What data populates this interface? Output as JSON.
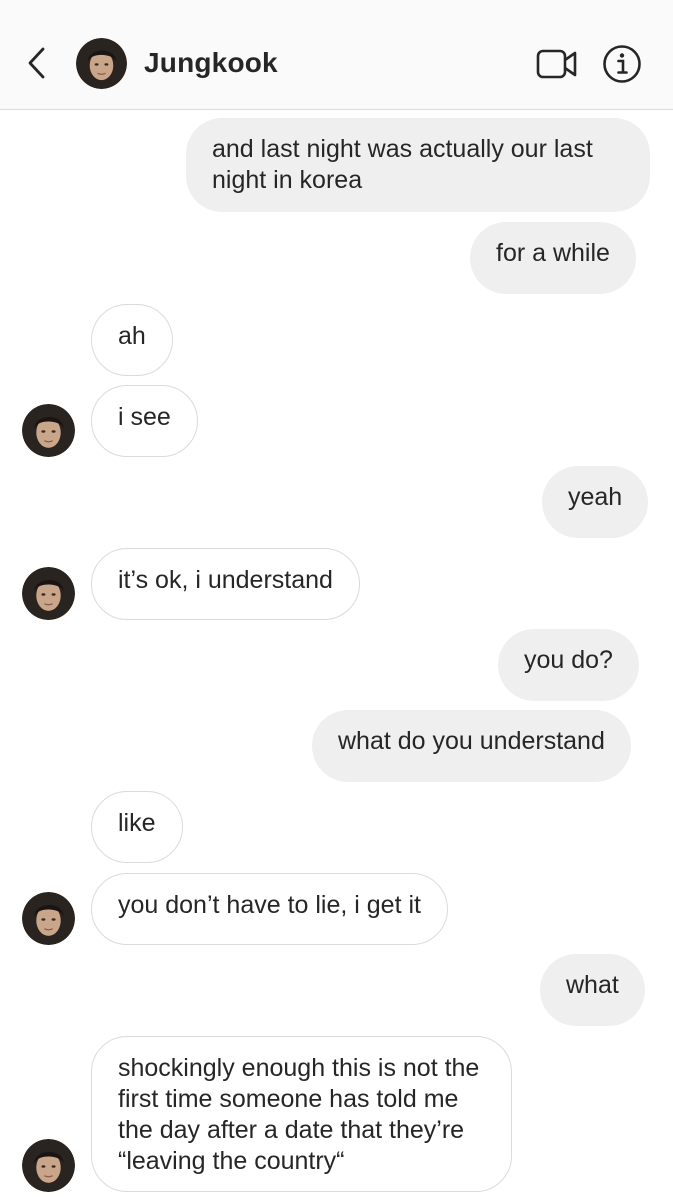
{
  "header": {
    "contact_name": "Jungkook",
    "back_icon": "chevron-left-icon",
    "video_icon": "video-camera-icon",
    "info_icon": "info-icon"
  },
  "colors": {
    "outgoing_bubble": "#efefef",
    "incoming_border": "#dbdbdb",
    "header_bg": "#fafafa",
    "text": "#262626"
  },
  "messages": [
    {
      "direction": "outgoing",
      "text": "and last night was actually our last night in korea"
    },
    {
      "direction": "outgoing",
      "text": "for a while"
    },
    {
      "direction": "incoming",
      "text": "ah"
    },
    {
      "direction": "incoming",
      "text": "i see"
    },
    {
      "direction": "outgoing",
      "text": "yeah"
    },
    {
      "direction": "incoming",
      "text": "it’s ok, i understand"
    },
    {
      "direction": "outgoing",
      "text": "you do?"
    },
    {
      "direction": "outgoing",
      "text": "what do you understand"
    },
    {
      "direction": "incoming",
      "text": "like"
    },
    {
      "direction": "incoming",
      "text": "you don’t have to lie, i get it"
    },
    {
      "direction": "outgoing",
      "text": "what"
    },
    {
      "direction": "incoming",
      "text": "shockingly enough this is not the first time someone has told me the day after a date that they’re “leaving the country“"
    }
  ]
}
